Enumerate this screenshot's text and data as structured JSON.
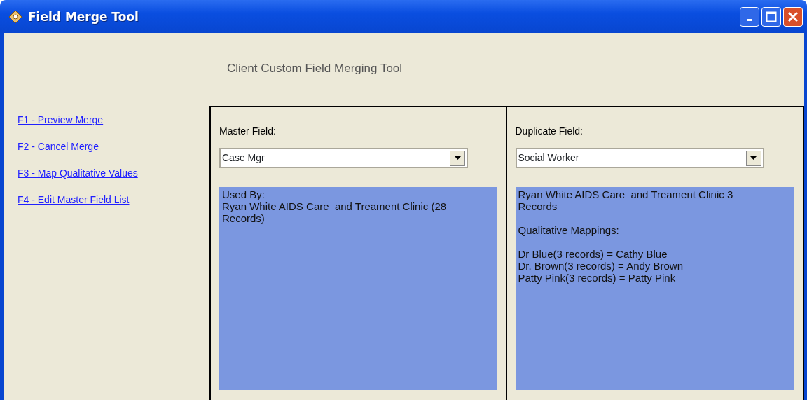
{
  "window": {
    "title": "Field Merge Tool"
  },
  "heading": "Client Custom Field Merging Tool",
  "links": [
    "F1 - Preview Merge",
    "F2 - Cancel Merge",
    "F3 - Map Qualitative Values",
    "F4 - Edit Master Field List"
  ],
  "panels": [
    {
      "label": "Master Field:",
      "value": "Case Mgr",
      "blocks": [
        [
          "Used By:",
          "Ryan White AIDS Care  and Treament Clinic (28 Records)"
        ]
      ]
    },
    {
      "label": "Duplicate Field:",
      "value": "Social Worker",
      "blocks": [
        [
          "Ryan White AIDS Care  and Treament Clinic 3 Records"
        ],
        [
          "Qualitative Mappings:"
        ],
        [
          "Dr Blue(3 records) = Cathy Blue",
          "Dr. Brown(3 records) = Andy Brown",
          "Patty Pink(3 records) = Patty Pink"
        ]
      ]
    }
  ]
}
